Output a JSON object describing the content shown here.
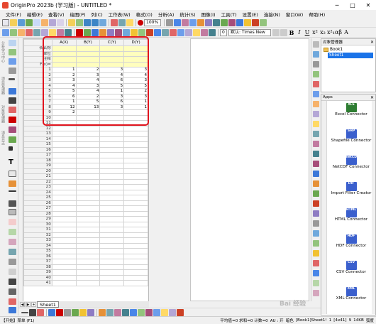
{
  "titlebar": {
    "title": "OriginPro 2023b (学习版) - UNTITLED *",
    "minimize": "─",
    "maximize": "□",
    "close": "✕"
  },
  "menubar": {
    "items": [
      "文件(F)",
      "编辑(E)",
      "查看(V)",
      "绘图(P)",
      "列(C)",
      "工作表(W)",
      "格式(O)",
      "分析(A)",
      "统计(S)",
      "图像(I)",
      "工具(T)",
      "设置(E)",
      "连接(N)",
      "窗口(W)",
      "帮助(H)"
    ]
  },
  "toolbar": {
    "zoom": "100%",
    "font_size_value": "0",
    "font_name": "默认: Times New"
  },
  "format_buttons": [
    "B",
    "I",
    "U",
    "x²",
    "x₂",
    "x²₁",
    "αβ",
    "A"
  ],
  "lefttb_labels": [
    "分析学习中心",
    "项目管理器",
    "对象管理器",
    "消息日志"
  ],
  "worksheet": {
    "columns": [
      "A(X)",
      "B(Y)",
      "C(Y)",
      "D(Y)"
    ],
    "meta_labels": [
      "长名称",
      "单位",
      "注释",
      "F(x)="
    ],
    "rows": [
      [
        "1",
        "1",
        "2",
        "3",
        "3"
      ],
      [
        "2",
        "2",
        "3",
        "4",
        "4"
      ],
      [
        "3",
        "3",
        "4",
        "6",
        "3"
      ],
      [
        "4",
        "4",
        "3",
        "5",
        "5"
      ],
      [
        "5",
        "5",
        "4",
        "1",
        "2"
      ],
      [
        "6",
        "6",
        "2",
        "3",
        "3"
      ],
      [
        "7",
        "1",
        "5",
        "6",
        "1"
      ],
      [
        "8",
        "12",
        "13",
        "3",
        "1"
      ],
      [
        "9",
        "2",
        "",
        "",
        ""
      ],
      [
        "10",
        "",
        "",
        "",
        ""
      ],
      [
        "11",
        "",
        "",
        "",
        ""
      ],
      [
        "12",
        "",
        "",
        "",
        ""
      ],
      [
        "13",
        "",
        "",
        "",
        ""
      ],
      [
        "14",
        "",
        "",
        "",
        ""
      ],
      [
        "15",
        "",
        "",
        "",
        ""
      ],
      [
        "16",
        "",
        "",
        "",
        ""
      ],
      [
        "17",
        "",
        "",
        "",
        ""
      ],
      [
        "18",
        "",
        "",
        "",
        ""
      ],
      [
        "19",
        "",
        "",
        "",
        ""
      ],
      [
        "20",
        "",
        "",
        "",
        ""
      ],
      [
        "21",
        "",
        "",
        "",
        ""
      ],
      [
        "22",
        "",
        "",
        "",
        ""
      ],
      [
        "23",
        "",
        "",
        "",
        ""
      ],
      [
        "24",
        "",
        "",
        "",
        ""
      ],
      [
        "25",
        "",
        "",
        "",
        ""
      ],
      [
        "26",
        "",
        "",
        "",
        ""
      ],
      [
        "27",
        "",
        "",
        "",
        ""
      ],
      [
        "28",
        "",
        "",
        "",
        ""
      ],
      [
        "29",
        "",
        "",
        "",
        ""
      ],
      [
        "30",
        "",
        "",
        "",
        ""
      ],
      [
        "31",
        "",
        "",
        "",
        ""
      ],
      [
        "32",
        "",
        "",
        "",
        ""
      ],
      [
        "33",
        "",
        "",
        "",
        ""
      ],
      [
        "34",
        "",
        "",
        "",
        ""
      ],
      [
        "35",
        "",
        "",
        "",
        ""
      ],
      [
        "36",
        "",
        "",
        "",
        ""
      ],
      [
        "37",
        "",
        "",
        "",
        ""
      ],
      [
        "38",
        "",
        "",
        "",
        ""
      ],
      [
        "39",
        "",
        "",
        "",
        ""
      ],
      [
        "40",
        "",
        "",
        "",
        ""
      ],
      [
        "41",
        "",
        "",
        "",
        ""
      ]
    ],
    "sheet_tab": "Sheet1",
    "tab_nav": [
      "◀",
      "▶",
      "+"
    ]
  },
  "object_manager": {
    "title": "对象管理器",
    "book": "Book1",
    "sheet": "Sheet1"
  },
  "apps": {
    "title": "Apps",
    "items": [
      {
        "icon": "XLS",
        "name": "Excel Connector",
        "color": "#2e7d32"
      },
      {
        "icon": "SHP",
        "name": "Shapefile Connector",
        "color": "#3a5fcd"
      },
      {
        "icon": "netCDF",
        "name": "NetCDF Connector",
        "color": "#3a5fcd"
      },
      {
        "icon": "DIF",
        "name": "Import Filter Creator",
        "color": "#3a5fcd"
      },
      {
        "icon": "HTML",
        "name": "HTML Connector",
        "color": "#3a5fcd"
      },
      {
        "icon": "HDF",
        "name": "HDF Connector",
        "color": "#3a5fcd"
      },
      {
        "icon": "CSV",
        "name": "CSV Connector",
        "color": "#3a5fcd"
      },
      {
        "icon": "XML",
        "name": "XML Connector",
        "color": "#3a5fcd"
      }
    ]
  },
  "statusbar": {
    "start": "【开始】菜单 (F1)",
    "avg": "平均值=0 求和=0 计数=0",
    "au": "AU : 开",
    "dark": "暗色",
    "cell": "[Book1]Sheet1!",
    "range": "1",
    "loc": "[4x41]",
    "size": "9",
    "mem": "14KB",
    "rad": "弧度"
  },
  "watermark": "Bai 经验"
}
